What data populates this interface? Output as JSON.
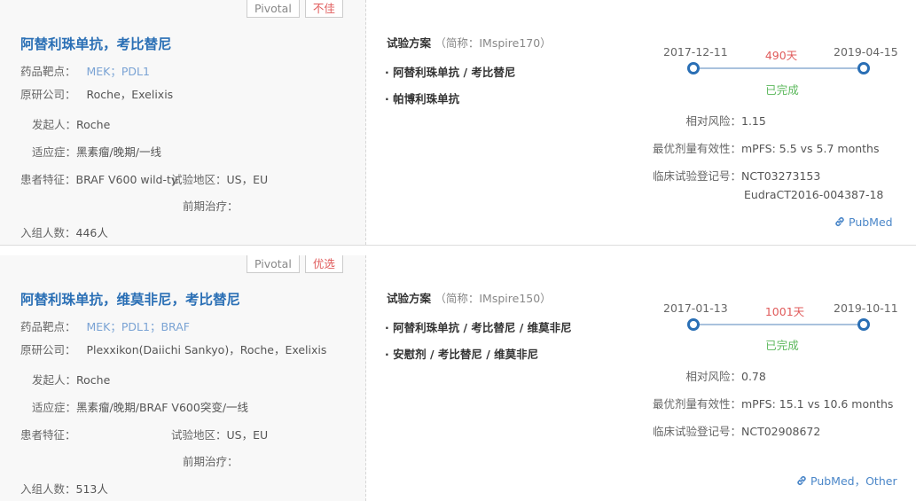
{
  "trials": [
    {
      "tags": [
        {
          "label": "Pivotal",
          "tone": "grey"
        },
        {
          "label": "不佳",
          "tone": "red"
        }
      ],
      "title": "阿替利珠单抗，考比替尼",
      "target_label": "药品靶点：",
      "target_value": "MEK；PDL1",
      "company_label": "原研公司：",
      "company_value": "Roche，Exelixis",
      "sponsor_label": "发起人：",
      "sponsor_value": "Roche",
      "indication_label": "适应症：",
      "indication_value": "黑素瘤/晚期/一线",
      "patient_label": "患者特征：",
      "patient_value": "BRAF V600 wild-ty",
      "region_label": "试验地区：",
      "region_value": "US，EU",
      "prior_label": "前期治疗：",
      "prior_value": "",
      "enroll_label": "入组人数：",
      "enroll_value": "446人",
      "plan_label": "试验方案",
      "plan_short": "（简称：IMspire170）",
      "arms": [
        "阿替利珠单抗 / 考比替尼",
        "帕博利珠单抗"
      ],
      "start_date": "2017-12-11",
      "end_date": "2019-04-15",
      "days": "490天",
      "status": "已完成",
      "risk_label": "相对风险：",
      "risk_value": "1.15",
      "efficacy_label": "最优剂量有效性：",
      "efficacy_value": "mPFS: 5.5 vs 5.7 months",
      "reg_label": "临床试验登记号：",
      "reg_values": [
        "NCT03273153",
        "EudraCT2016-004387-18"
      ],
      "links": "PubMed"
    },
    {
      "tags": [
        {
          "label": "Pivotal",
          "tone": "grey"
        },
        {
          "label": "优选",
          "tone": "red"
        }
      ],
      "title": "阿替利珠单抗，维莫非尼，考比替尼",
      "target_label": "药品靶点：",
      "target_value": "MEK；PDL1；BRAF",
      "company_label": "原研公司：",
      "company_value": "Plexxikon(Daiichi Sankyo)，Roche，Exelixis",
      "sponsor_label": "发起人：",
      "sponsor_value": "Roche",
      "indication_label": "适应症：",
      "indication_value": "黑素瘤/晚期/BRAF V600突变/一线",
      "patient_label": "患者特征：",
      "patient_value": "",
      "region_label": "试验地区：",
      "region_value": "US，EU",
      "prior_label": "前期治疗：",
      "prior_value": "",
      "enroll_label": "入组人数：",
      "enroll_value": "513人",
      "plan_label": "试验方案",
      "plan_short": "（简称：IMspire150）",
      "arms": [
        "阿替利珠单抗 / 考比替尼 / 维莫非尼",
        "安慰剂 / 考比替尼 / 维莫非尼"
      ],
      "start_date": "2017-01-13",
      "end_date": "2019-10-11",
      "days": "1001天",
      "status": "已完成",
      "risk_label": "相对风险：",
      "risk_value": "0.78",
      "efficacy_label": "最优剂量有效性：",
      "efficacy_value": "mPFS: 15.1 vs 10.6 months",
      "reg_label": "临床试验登记号：",
      "reg_values": [
        "NCT02908672"
      ],
      "links": "PubMed，Other"
    }
  ],
  "colors": {
    "title": "#2a6fb5",
    "accent_red": "#e05b5b",
    "status_green": "#5cb85c",
    "link": "#4a86c8"
  },
  "icons": {
    "link": "link-icon"
  }
}
